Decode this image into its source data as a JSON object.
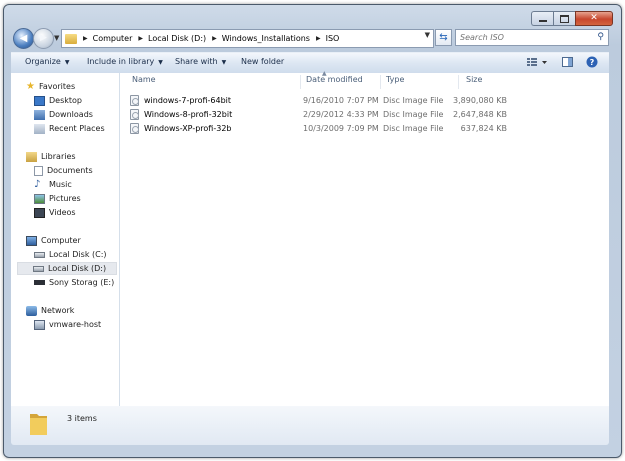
{
  "caption": {
    "minimize_icon": "minimize-icon",
    "maximize_icon": "maximize-icon",
    "close_icon": "close-icon"
  },
  "address": {
    "segments": [
      "Computer",
      "Local Disk (D:)",
      "Windows_Installations",
      "ISO"
    ],
    "search_placeholder": "Search ISO"
  },
  "toolbar": {
    "organize": "Organize",
    "include": "Include in library",
    "share": "Share with",
    "new_folder": "New folder"
  },
  "nav": {
    "favorites": "Favorites",
    "desktop": "Desktop",
    "downloads": "Downloads",
    "recent": "Recent Places",
    "libraries": "Libraries",
    "documents": "Documents",
    "music": "Music",
    "pictures": "Pictures",
    "videos": "Videos",
    "computer": "Computer",
    "disk_c": "Local Disk (C:)",
    "disk_d": "Local Disk (D:)",
    "sony": "Sony Storag (E:)",
    "network": "Network",
    "vmware": "vmware-host"
  },
  "columns": {
    "name": "Name",
    "date": "Date modified",
    "type": "Type",
    "size": "Size"
  },
  "files": [
    {
      "name": "windows-7-profi-64bit",
      "date": "9/16/2010 7:07 PM",
      "type": "Disc Image File",
      "size": "3,890,080 KB"
    },
    {
      "name": "Windows-8-profi-32bit",
      "date": "2/29/2012 4:33 PM",
      "type": "Disc Image File",
      "size": "2,647,848 KB"
    },
    {
      "name": "Windows-XP-profi-32b",
      "date": "10/3/2009 7:09 PM",
      "type": "Disc Image File",
      "size": "637,824 KB"
    }
  ],
  "status": {
    "count": "3 items"
  },
  "colors": {
    "accent": "#2766b8",
    "folder": "#e8c14f",
    "selection": "#e6e9ee"
  }
}
